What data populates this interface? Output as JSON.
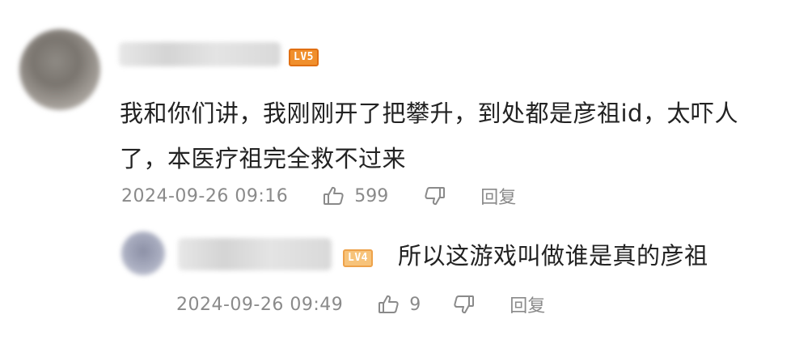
{
  "comment": {
    "level_badge": "LV5",
    "text": "我和你们讲，我刚刚开了把攀升，到处都是彦祖id，太吓人了，本医疗祖完全救不过来",
    "timestamp": "2024-09-26 09:16",
    "like_count": "599",
    "reply_label": "回复"
  },
  "reply": {
    "level_badge": "LV4",
    "text": "所以这游戏叫做谁是真的彦祖",
    "timestamp": "2024-09-26 09:49",
    "like_count": "9",
    "reply_label": "回复"
  },
  "colors": {
    "text": "#222222",
    "meta": "#8a8a8a",
    "lv5_badge": "#f08f2c",
    "lv4_badge": "#f7c37a"
  },
  "icons": [
    "thumbs-up-icon",
    "thumbs-down-icon"
  ]
}
